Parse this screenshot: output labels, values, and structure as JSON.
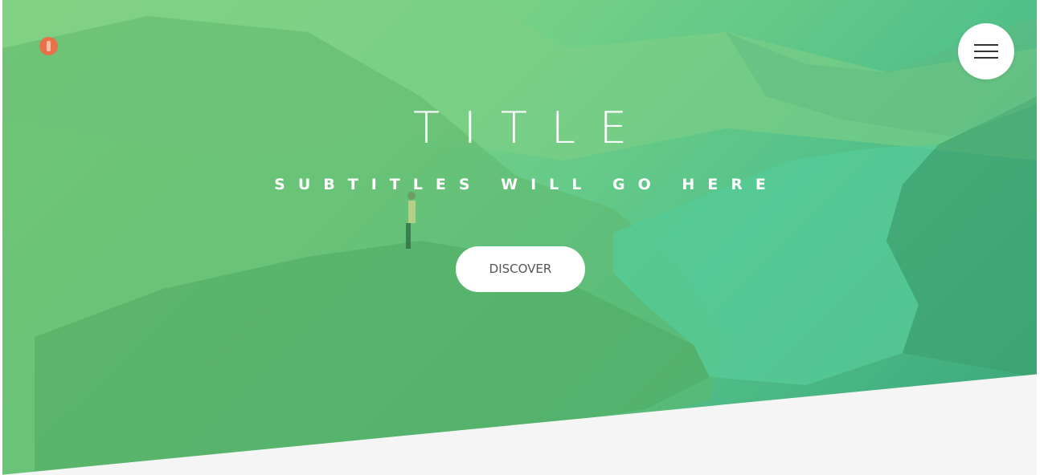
{
  "hero": {
    "title": "TITLE",
    "subtitle": "SUBTITLES WILL GO HERE",
    "cta_label": "DISCOVER"
  },
  "header": {
    "logo_icon": "logo-icon",
    "menu_icon": "hamburger-menu-icon"
  },
  "colors": {
    "overlay_start": "#86d680",
    "overlay_end": "#3aa57a",
    "logo": "#e8714a",
    "button_bg": "#ffffff",
    "button_text": "#555555",
    "section_bg": "#f5f5f5"
  }
}
